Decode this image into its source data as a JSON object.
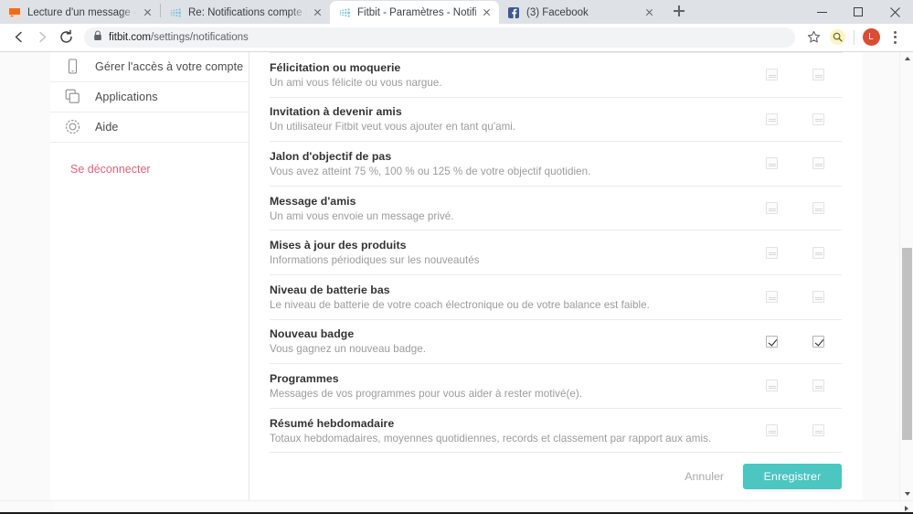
{
  "window": {
    "minimize_label": "Réduire",
    "maximize_label": "Agrandir",
    "close_label": "Fermer"
  },
  "tabs": [
    {
      "title": "Lecture d'un message - mail Ora",
      "favicon": "orange-square-favicon",
      "active": false
    },
    {
      "title": "Re: Notifications compte Fitbit. -",
      "favicon": "fitbit-favicon",
      "active": false
    },
    {
      "title": "Fitbit - Paramètres - Notifications",
      "favicon": "fitbit-favicon",
      "active": true
    },
    {
      "title": "(3) Facebook",
      "favicon": "facebook-favicon",
      "active": false
    }
  ],
  "toolbar": {
    "back_label": "Précédent",
    "forward_label": "Suivant",
    "reload_label": "Actualiser",
    "url_domain": "fitbit.com",
    "url_path": "/settings/notifications",
    "bookmark_label": "Ajouter aux favoris",
    "extension_label": "Extension",
    "profile_initial": "L",
    "menu_label": "Personnaliser et contrôler Google Chrome"
  },
  "sidebar": {
    "items": [
      {
        "label": "Gérer l'accès à votre compte",
        "icon": "device-icon"
      },
      {
        "label": "Applications",
        "icon": "apps-icon"
      },
      {
        "label": "Aide",
        "icon": "help-icon"
      }
    ],
    "logout_label": "Se déconnecter"
  },
  "notifications": {
    "rows": [
      {
        "title": "Félicitation ou moquerie",
        "description": "Un ami vous félicite ou vous nargue.",
        "col1_checked": false,
        "col2_checked": false
      },
      {
        "title": "Invitation à devenir amis",
        "description": "Un utilisateur Fitbit veut vous ajouter en tant qu'ami.",
        "col1_checked": false,
        "col2_checked": false
      },
      {
        "title": "Jalon d'objectif de pas",
        "description": "Vous avez atteint 75 %, 100 % ou 125 % de votre objectif quotidien.",
        "col1_checked": false,
        "col2_checked": false
      },
      {
        "title": "Message d'amis",
        "description": "Un ami vous envoie un message privé.",
        "col1_checked": false,
        "col2_checked": false
      },
      {
        "title": "Mises à jour des produits",
        "description": "Informations périodiques sur les nouveautés",
        "col1_checked": false,
        "col2_checked": false
      },
      {
        "title": "Niveau de batterie bas",
        "description": "Le niveau de batterie de votre coach électronique ou de votre balance est faible.",
        "col1_checked": false,
        "col2_checked": false
      },
      {
        "title": "Nouveau badge",
        "description": "Vous gagnez un nouveau badge.",
        "col1_checked": true,
        "col2_checked": true
      },
      {
        "title": "Programmes",
        "description": "Messages de vos programmes pour vous aider à rester motivé(e).",
        "col1_checked": false,
        "col2_checked": false
      },
      {
        "title": "Résumé hebdomadaire",
        "description": "Totaux hebdomadaires, moyennes quotidiennes, records et classement par rapport aux amis.",
        "col1_checked": false,
        "col2_checked": false
      }
    ],
    "cancel_label": "Annuler",
    "save_label": "Enregistrer"
  },
  "colors": {
    "accent_teal": "#4bc6c0",
    "logout_pink": "#e8607f",
    "title_text": "#333333",
    "desc_text": "#9b9b9b"
  }
}
